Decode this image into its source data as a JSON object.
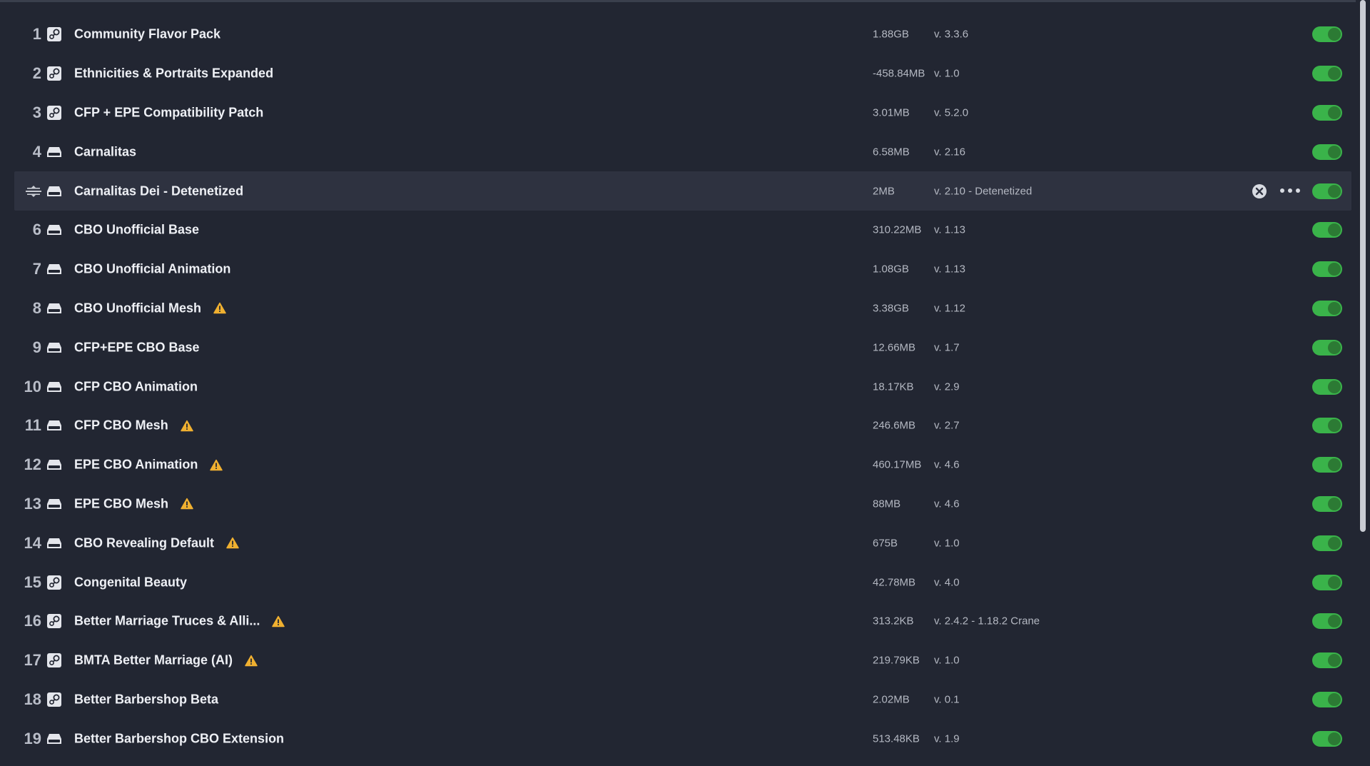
{
  "mods": [
    {
      "index": "1",
      "source": "steam",
      "name": "Community Flavor Pack",
      "size": "1.88GB",
      "version": "v. 3.3.6",
      "warning": false,
      "enabled": true
    },
    {
      "index": "2",
      "source": "steam",
      "name": "Ethnicities & Portraits Expanded",
      "size": "-458.84MB",
      "version": "v. 1.0",
      "warning": false,
      "enabled": true
    },
    {
      "index": "3",
      "source": "steam",
      "name": "CFP + EPE Compatibility Patch",
      "size": "3.01MB",
      "version": "v. 5.2.0",
      "warning": false,
      "enabled": true
    },
    {
      "index": "4",
      "source": "local",
      "name": "Carnalitas",
      "size": "6.58MB",
      "version": "v. 2.16",
      "warning": false,
      "enabled": true
    },
    {
      "index": "",
      "source": "local",
      "name": "Carnalitas Dei - Detenetized",
      "size": "2MB",
      "version": "v. 2.10 - Detenetized",
      "warning": false,
      "enabled": true,
      "selected": true
    },
    {
      "index": "6",
      "source": "local",
      "name": "CBO Unofficial Base",
      "size": "310.22MB",
      "version": "v. 1.13",
      "warning": false,
      "enabled": true
    },
    {
      "index": "7",
      "source": "local",
      "name": "CBO Unofficial Animation",
      "size": "1.08GB",
      "version": "v. 1.13",
      "warning": false,
      "enabled": true
    },
    {
      "index": "8",
      "source": "local",
      "name": "CBO Unofficial Mesh",
      "size": "3.38GB",
      "version": "v. 1.12",
      "warning": true,
      "enabled": true
    },
    {
      "index": "9",
      "source": "local",
      "name": "CFP+EPE CBO Base",
      "size": "12.66MB",
      "version": "v. 1.7",
      "warning": false,
      "enabled": true
    },
    {
      "index": "10",
      "source": "local",
      "name": "CFP CBO Animation",
      "size": "18.17KB",
      "version": "v. 2.9",
      "warning": false,
      "enabled": true
    },
    {
      "index": "11",
      "source": "local",
      "name": "CFP CBO Mesh",
      "size": "246.6MB",
      "version": "v. 2.7",
      "warning": true,
      "enabled": true
    },
    {
      "index": "12",
      "source": "local",
      "name": "EPE CBO Animation",
      "size": "460.17MB",
      "version": "v. 4.6",
      "warning": true,
      "enabled": true
    },
    {
      "index": "13",
      "source": "local",
      "name": "EPE CBO Mesh",
      "size": "88MB",
      "version": "v. 4.6",
      "warning": true,
      "enabled": true
    },
    {
      "index": "14",
      "source": "local",
      "name": "CBO Revealing Default",
      "size": "675B",
      "version": "v. 1.0",
      "warning": true,
      "enabled": true
    },
    {
      "index": "15",
      "source": "steam",
      "name": "Congenital Beauty",
      "size": "42.78MB",
      "version": "v. 4.0",
      "warning": false,
      "enabled": true
    },
    {
      "index": "16",
      "source": "steam",
      "name": "Better Marriage Truces & Alli...",
      "size": "313.2KB",
      "version": "v. 2.4.2 - 1.18.2 Crane",
      "warning": true,
      "enabled": true
    },
    {
      "index": "17",
      "source": "steam",
      "name": "BMTA Better Marriage (AI)",
      "size": "219.79KB",
      "version": "v. 1.0",
      "warning": true,
      "enabled": true
    },
    {
      "index": "18",
      "source": "steam",
      "name": "Better Barbershop Beta",
      "size": "2.02MB",
      "version": "v. 0.1",
      "warning": false,
      "enabled": true
    },
    {
      "index": "19",
      "source": "local",
      "name": "Better Barbershop CBO Extension",
      "size": "513.48KB",
      "version": "v. 1.9",
      "warning": false,
      "enabled": true
    }
  ],
  "colors": {
    "background": "#222632",
    "selected_row": "#2e3240",
    "toggle_on": "#3ab34a",
    "warning": "#f0b030"
  },
  "icons": {
    "steam": "steam-icon",
    "local": "local-drive-icon",
    "warning": "warning-icon",
    "drag": "drag-handle-icon",
    "remove": "remove-icon",
    "more": "more-options-icon"
  }
}
